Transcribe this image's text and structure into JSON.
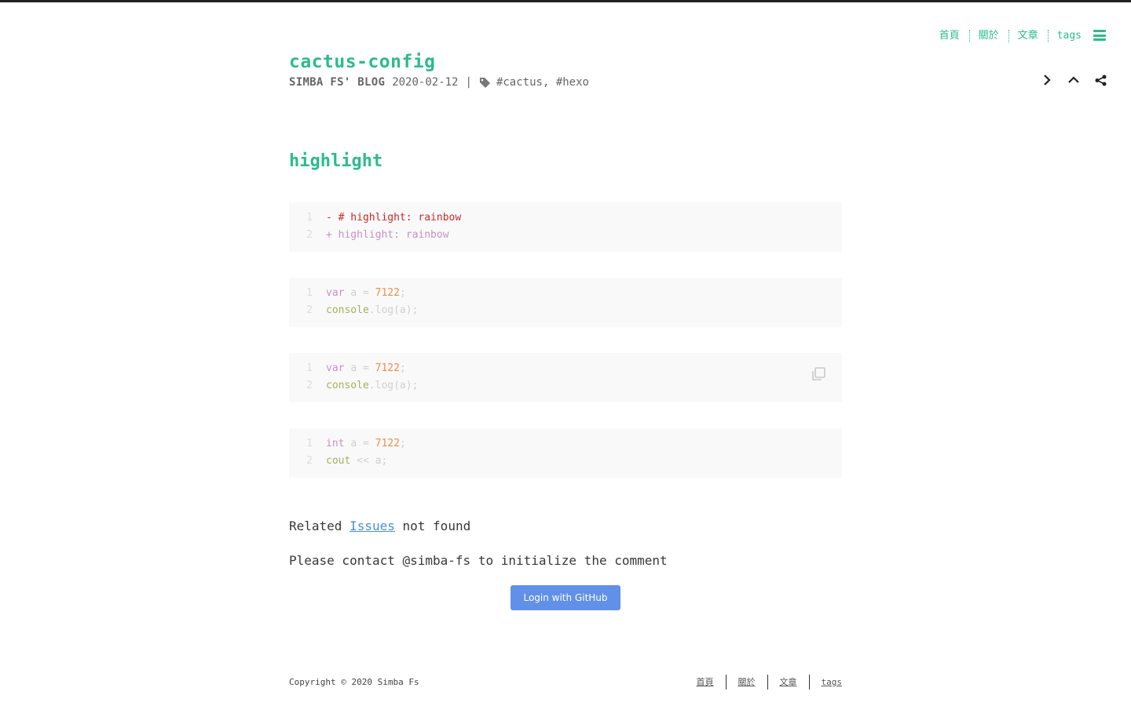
{
  "nav": {
    "items": [
      {
        "label": "首頁"
      },
      {
        "label": "關於"
      },
      {
        "label": "文章"
      },
      {
        "label": "tags"
      }
    ]
  },
  "post": {
    "title": "cactus-config",
    "author": "SIMBA FS' BLOG",
    "date": "2020-02-12",
    "separator": "|",
    "tags": [
      "#cactus,",
      "#hexo"
    ]
  },
  "section": {
    "heading": "highlight"
  },
  "code_blocks": [
    {
      "lines": [
        {
          "num": "1",
          "text": "- # highlight: rainbow"
        },
        {
          "num": "2",
          "text": "+ highlight: rainbow"
        }
      ]
    },
    {
      "lines": [
        {
          "num": "1",
          "tokens": [
            "var",
            "a",
            "=",
            "7122",
            ";"
          ]
        },
        {
          "num": "2",
          "tokens": [
            "console",
            ".log(a);"
          ]
        }
      ]
    },
    {
      "lines": [
        {
          "num": "1",
          "tokens": [
            "var",
            "a",
            "=",
            "7122",
            ";"
          ]
        },
        {
          "num": "2",
          "tokens": [
            "console",
            ".log(a);"
          ]
        }
      ]
    },
    {
      "lines": [
        {
          "num": "1",
          "tokens": [
            "int",
            "a",
            "=",
            "7122",
            ";"
          ]
        },
        {
          "num": "2",
          "tokens": [
            "cout",
            "<<",
            "a;"
          ]
        }
      ]
    }
  ],
  "comments": {
    "related_prefix": "Related",
    "issues_link": "Issues",
    "related_suffix": "not found",
    "contact_text": "Please contact @simba-fs to initialize the comment",
    "login_label": "Login with GitHub"
  },
  "footer": {
    "copyright": "Copyright © 2020 Simba Fs",
    "links": [
      {
        "label": "首頁"
      },
      {
        "label": "關於"
      },
      {
        "label": "文章"
      },
      {
        "label": "tags"
      }
    ]
  },
  "colors": {
    "accent": "#2bbc8a",
    "button": "#6190e8"
  }
}
